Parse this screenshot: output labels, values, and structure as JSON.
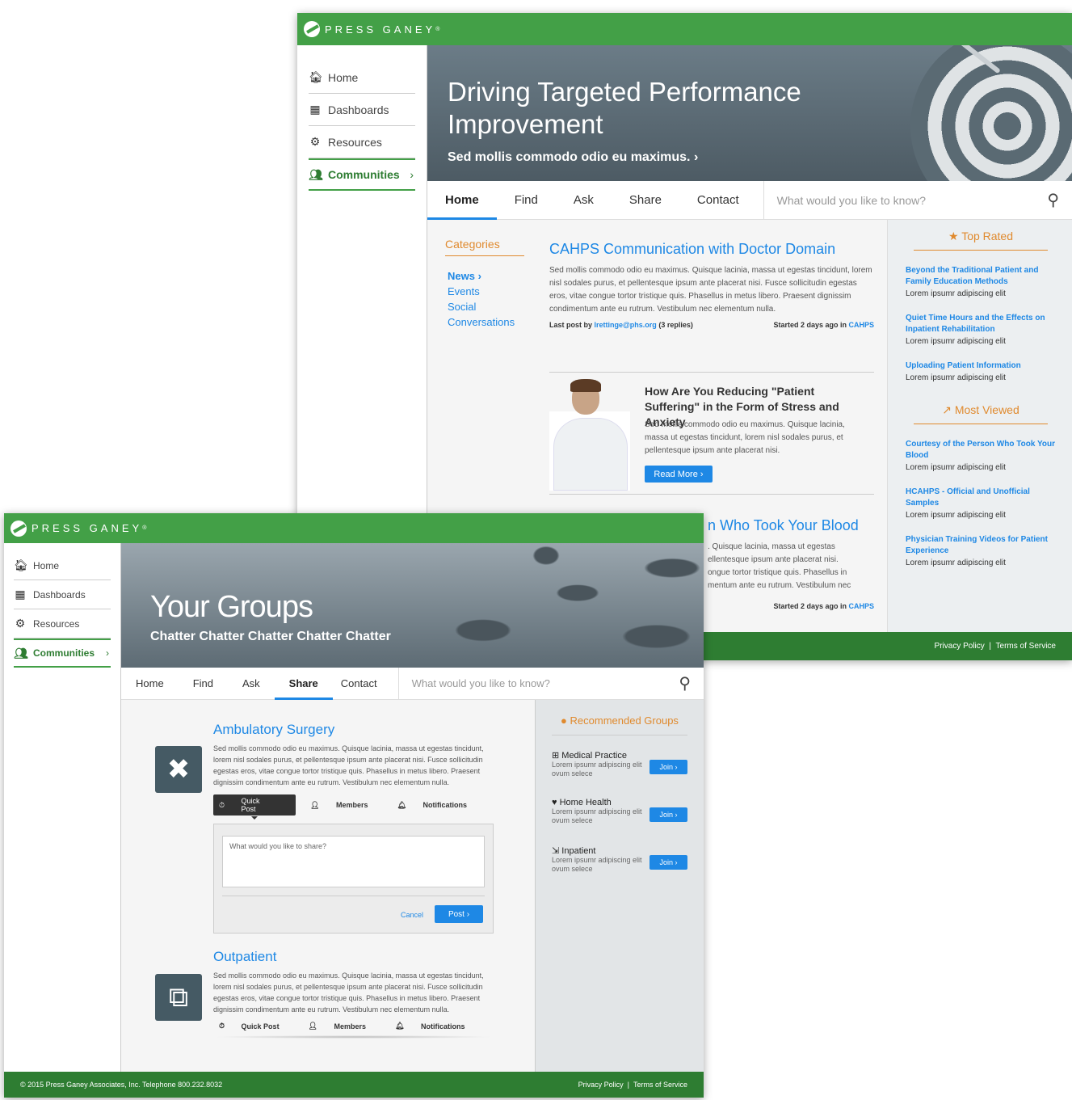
{
  "back_window": {
    "logo": "PRESS GANEY",
    "nav": [
      {
        "label": "Home",
        "icon": "home-icon"
      },
      {
        "label": "Dashboards",
        "icon": "dashboard-icon"
      },
      {
        "label": "Resources",
        "icon": "gear-icon"
      },
      {
        "label": "Communities",
        "icon": "people-icon",
        "active": true
      }
    ],
    "hero": {
      "title": "Driving Targeted Performance Improvement",
      "subtitle": "Sed mollis commodo odio eu maximus."
    },
    "tabs": [
      {
        "label": "Home",
        "active": true
      },
      {
        "label": "Find"
      },
      {
        "label": "Ask"
      },
      {
        "label": "Share"
      },
      {
        "label": "Contact"
      }
    ],
    "search_placeholder": "What would you like to know?",
    "categories": {
      "heading": "Categories",
      "items": [
        "News",
        "Events",
        "Social",
        "Conversations"
      ]
    },
    "article1": {
      "title": "CAHPS Communication with Doctor Domain",
      "body": "Sed mollis commodo odio eu maximus. Quisque lacinia, massa ut egestas tincidunt, lorem nisl sodales purus, et pellentesque ipsum ante placerat nisi. Fusce sollicitudin egestas eros, vitae congue tortor tristique quis. Phasellus in metus libero. Praesent dignissim condimentum ante eu rutrum. Vestibulum nec elementum nulla.",
      "last_post_prefix": "Last post by",
      "last_post_email": "lrettinge@phs.org",
      "replies": "(3 replies)",
      "started": "Started 2 days ago in",
      "started_link": "CAHPS"
    },
    "feature": {
      "title": "How Are You Reducing \"Patient Suffering\" in the Form of Stress and Anxiety",
      "body": "Sed mollis commodo odio eu maximus. Quisque lacinia, massa ut egestas tincidunt, lorem nisl sodales purus, et pellentesque ipsum ante placerat nisi.",
      "button": "Read More"
    },
    "article2": {
      "title": "n Who Took Your Blood",
      "lines": [
        ". Quisque lacinia, massa ut egestas",
        "ellentesque ipsum ante placerat nisi.",
        "ongue tortor tristique quis. Phasellus in",
        "mentum ante eu rutrum. Vestibulum nec"
      ],
      "started": "Started 2 days ago in",
      "started_link": "CAHPS"
    },
    "top_rated": {
      "heading": "Top Rated",
      "items": [
        {
          "title": "Beyond the Traditional Patient and Family Education Methods",
          "desc": "Lorem ipsumr adipiscing elit"
        },
        {
          "title": "Quiet Time Hours and the Effects on Inpatient Rehabilitation",
          "desc": "Lorem ipsumr adipiscing elit"
        },
        {
          "title": "Uploading Patient Information",
          "desc": "Lorem ipsumr adipiscing elit"
        }
      ]
    },
    "most_viewed": {
      "heading": "Most Viewed",
      "items": [
        {
          "title": "Courtesy of the Person Who Took Your Blood",
          "desc": "Lorem ipsumr adipiscing elit"
        },
        {
          "title": "HCAHPS - Official and Unofficial Samples",
          "desc": "Lorem ipsumr adipiscing elit"
        },
        {
          "title": "Physician Training Videos for Patient Experience",
          "desc": "Lorem ipsumr adipiscing elit"
        }
      ]
    },
    "footer": {
      "privacy": "Privacy Policy",
      "sep": "|",
      "terms": "Terms of Service"
    }
  },
  "front_window": {
    "logo": "PRESS GANEY",
    "nav": [
      {
        "label": "Home",
        "icon": "home-icon"
      },
      {
        "label": "Dashboards",
        "icon": "dashboard-icon"
      },
      {
        "label": "Resources",
        "icon": "gear-icon"
      },
      {
        "label": "Communities",
        "icon": "people-icon",
        "active": true
      }
    ],
    "hero": {
      "title": "Your Groups",
      "subtitle": "Chatter Chatter Chatter Chatter Chatter"
    },
    "tabs": [
      {
        "label": "Home"
      },
      {
        "label": "Find"
      },
      {
        "label": "Ask"
      },
      {
        "label": "Share",
        "active": true
      },
      {
        "label": "Contact"
      }
    ],
    "search_placeholder": "What would you like to know?",
    "groups": [
      {
        "title": "Ambulatory Surgery",
        "icon": "bandage-icon",
        "body": "Sed mollis commodo odio eu maximus. Quisque lacinia, massa ut egestas tincidunt, lorem nisl sodales purus, et pellentesque ipsum ante placerat nisi. Fusce sollicitudin egestas eros, vitae congue tortor tristique quis. Phasellus in metus libero. Praesent dignissim condimentum ante eu rutrum. Vestibulum nec elementum nulla."
      },
      {
        "title": "Outpatient",
        "icon": "external-link-icon",
        "body": "Sed mollis commodo odio eu maximus. Quisque lacinia, massa ut egestas tincidunt, lorem nisl sodales purus, et pellentesque ipsum ante placerat nisi. Fusce sollicitudin egestas eros, vitae congue tortor tristique quis. Phasellus in metus libero. Praesent dignissim condimentum ante eu rutrum. Vestibulum nec elementum nulla."
      }
    ],
    "actions": {
      "quick_post": "Quick Post",
      "members": "Members",
      "notifications": "Notifications"
    },
    "post_box": {
      "placeholder": "What would you like to share?",
      "cancel": "Cancel",
      "post": "Post"
    },
    "recommended": {
      "heading": "Recommended Groups",
      "items": [
        {
          "title": "Medical Practice",
          "icon": "plus-square-icon",
          "desc": "Lorem ipsumr adipiscing elit ovum selece",
          "button": "Join"
        },
        {
          "title": "Home Health",
          "icon": "heart-icon",
          "desc": "Lorem ipsumr adipiscing elit ovum selece",
          "button": "Join"
        },
        {
          "title": "Inpatient",
          "icon": "enter-icon",
          "desc": "Lorem ipsumr adipiscing elit ovum selece",
          "button": "Join"
        }
      ]
    },
    "footer": {
      "copyright": "© 2015 Press Ganey Associates, Inc. Telephone 800.232.8032",
      "privacy": "Privacy Policy",
      "sep": "|",
      "terms": "Terms of Service"
    }
  }
}
